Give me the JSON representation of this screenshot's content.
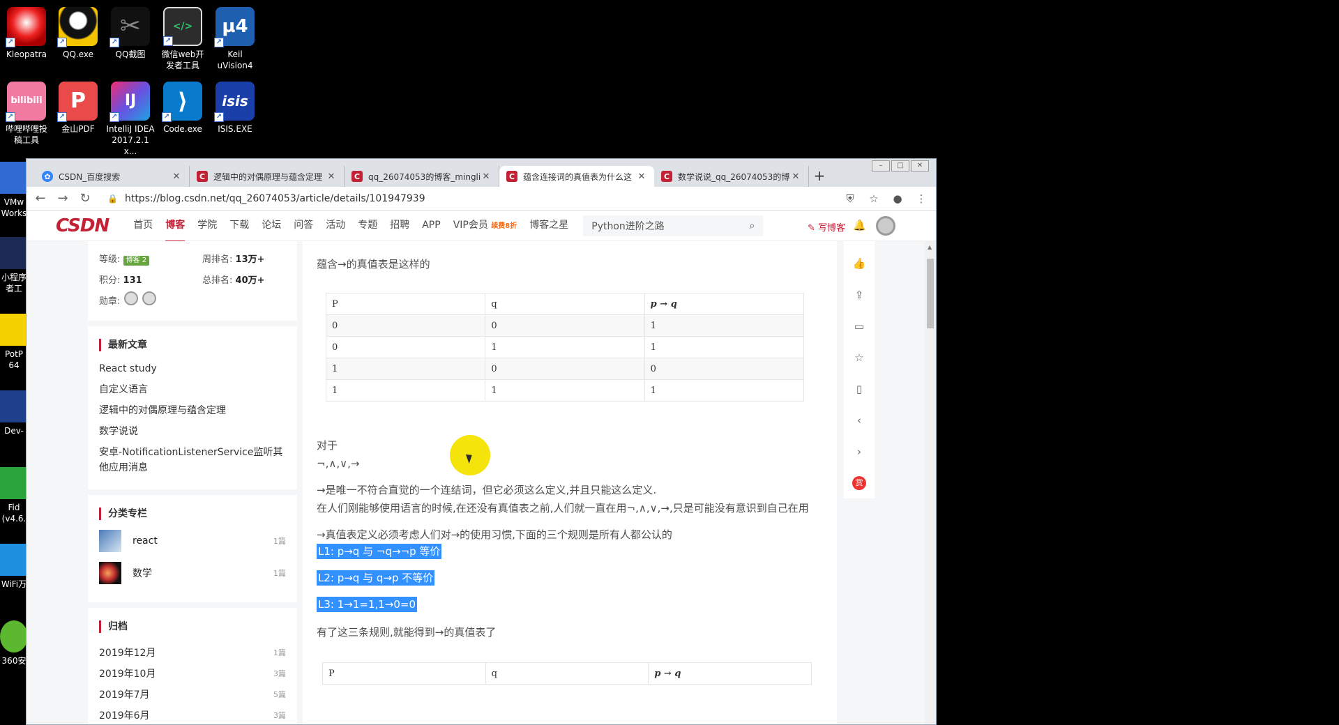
{
  "desktop": {
    "icons": [
      {
        "label": "Kleopatra",
        "line2": ""
      },
      {
        "label": "QQ.exe",
        "line2": ""
      },
      {
        "label": "QQ截图",
        "line2": ""
      },
      {
        "label": "微信web开",
        "line2": "发者工具"
      },
      {
        "label": "Keil",
        "line2": "uVision4"
      },
      {
        "label": "哔哩哔哩投",
        "line2": "稿工具"
      },
      {
        "label": "金山PDF",
        "line2": ""
      },
      {
        "label": "IntelliJ IDEA",
        "line2": "2017.2.1 x..."
      },
      {
        "label": "Code.exe",
        "line2": ""
      },
      {
        "label": "ISIS.EXE",
        "line2": ""
      }
    ],
    "left_partial": [
      "VMw",
      "Works",
      "小程序",
      "者工",
      "PotP",
      "64",
      "Dev-",
      "Fid",
      "(v4.6.",
      "WiFi万",
      "360安"
    ]
  },
  "browser": {
    "tabs": [
      {
        "title": "CSDN_百度搜索",
        "fav": "baidu"
      },
      {
        "title": "逻辑中的对偶原理与蕴含定理",
        "fav": "csdn"
      },
      {
        "title": "qq_26074053的博客_minglie",
        "fav": "csdn"
      },
      {
        "title": "蕴含连接词的真值表为什么这",
        "fav": "csdn"
      },
      {
        "title": "数学说说_qq_26074053的博",
        "fav": "csdn"
      }
    ],
    "url": "https://blog.csdn.net/qq_26074053/article/details/101947939"
  },
  "csdn": {
    "logo": "CSDN",
    "menu": [
      "首页",
      "博客",
      "学院",
      "下载",
      "论坛",
      "问答",
      "活动",
      "专题",
      "招聘",
      "APP",
      "VIP会员"
    ],
    "vip_sub": "续费8折",
    "star": "博客之星",
    "search_placeholder": "Python进阶之路",
    "write": "写博客"
  },
  "sidebar": {
    "level_label": "等级:",
    "level_badge": "博客 2",
    "week_rank_label": "周排名:",
    "week_rank": "13万+",
    "points_label": "积分:",
    "points": "131",
    "total_rank_label": "总排名:",
    "total_rank": "40万+",
    "medal_label": "勋章:",
    "latest_title": "最新文章",
    "latest": [
      "React study",
      "自定义语言",
      "逻辑中的对偶原理与蕴含定理",
      "数学说说",
      "安卓-NotificationListenerService监听其他应用消息"
    ],
    "category_title": "分类专栏",
    "categories": [
      {
        "name": "react",
        "count": "1篇"
      },
      {
        "name": "数学",
        "count": "1篇"
      }
    ],
    "archive_title": "归档",
    "archives": [
      {
        "month": "2019年12月",
        "count": "1篇"
      },
      {
        "month": "2019年10月",
        "count": "3篇"
      },
      {
        "month": "2019年7月",
        "count": "5篇"
      },
      {
        "month": "2019年6月",
        "count": "3篇"
      }
    ]
  },
  "article": {
    "intro": "蕴含→的真值表是这样的",
    "table_header": [
      "P",
      "q",
      "p → q"
    ],
    "table_rows": [
      [
        "0",
        "0",
        "1"
      ],
      [
        "0",
        "1",
        "1"
      ],
      [
        "1",
        "0",
        "0"
      ],
      [
        "1",
        "1",
        "1"
      ]
    ],
    "duiyu": "对于",
    "ops": "¬,∧,∨,→",
    "p1": "→是唯一不符合直觉的一个连结词，但它必须这么定义,并且只能这么定义.",
    "p2": "在人们刚能够使用语言的时候,在还没有真值表之前,人们就一直在用¬,∧,∨,→,只是可能没有意识到自己在用",
    "p3": "→真值表定义必须考虑人们对→的使用习惯,下面的三个规则是所有人都公认的",
    "l1": "L1: p→q 与 ¬q→¬p 等价",
    "l2": "L2: p→q 与 q→p 不等价",
    "l3": "L3: 1→1=1,1→0=0",
    "p4": "有了这三条规则,就能得到→的真值表了",
    "table2_header": [
      "P",
      "q",
      "p → q"
    ]
  }
}
